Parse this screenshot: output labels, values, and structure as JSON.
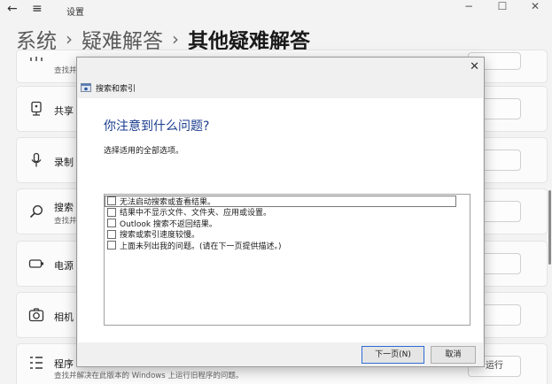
{
  "window": {
    "title": "设置",
    "back_glyph": "←",
    "menu_glyph": "≡",
    "minimize_glyph": "−",
    "maximize_glyph": "☐",
    "close_glyph": "✕"
  },
  "breadcrumb": {
    "root": "系统",
    "middle": "疑难解答",
    "current": "其他疑难解答",
    "separator": "›"
  },
  "rows": [
    {
      "icon": "network-icon",
      "title": "",
      "subtitle": "查找并"
    },
    {
      "icon": "shared-folder-icon",
      "title": "共享",
      "subtitle": ""
    },
    {
      "icon": "microphone-icon",
      "title": "录制",
      "subtitle": ""
    },
    {
      "icon": "search-icon",
      "title": "搜索",
      "subtitle": "查找并"
    },
    {
      "icon": "power-icon",
      "title": "电源",
      "subtitle": ""
    },
    {
      "icon": "camera-icon",
      "title": "相机",
      "subtitle": ""
    },
    {
      "icon": "compat-icon",
      "title": "程序",
      "subtitle": "查找并解决在此版本的 Windows 上运行旧程序的问题。",
      "button_label": "运行"
    }
  ],
  "dialog": {
    "window_title": "搜索和索引",
    "close_glyph": "✕",
    "heading": "你注意到什么问题?",
    "instruction": "选择适用的全部选项。",
    "options": [
      "无法启动搜索或查看结果。",
      "结果中不显示文件、文件夹、应用或设置。",
      "Outlook 搜索不返回结果。",
      "搜索或索引速度较慢。",
      "上面未列出我的问题。(请在下一页提供描述。)"
    ],
    "next_label": "下一页(N)",
    "cancel_label": "取消"
  },
  "colors": {
    "heading": "#1a3d8f",
    "accent_border": "#2f6bd6"
  }
}
